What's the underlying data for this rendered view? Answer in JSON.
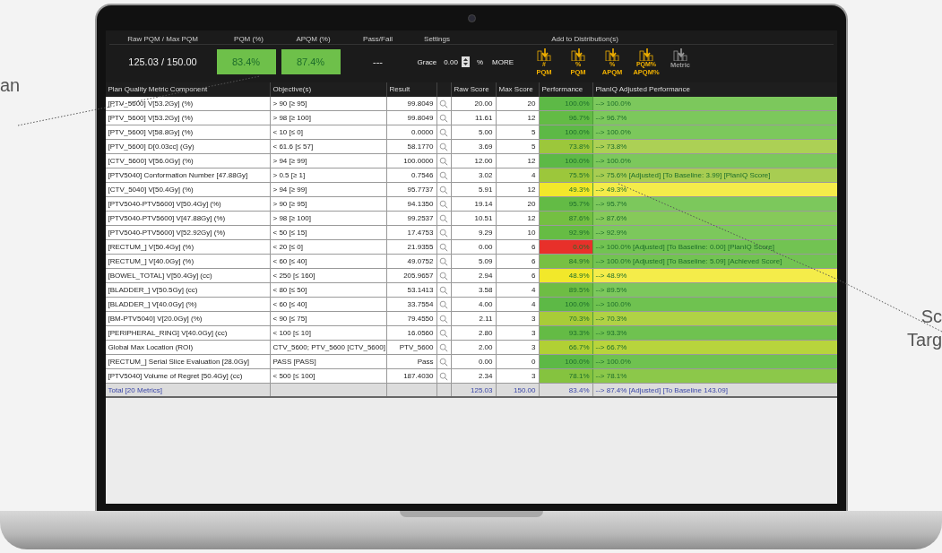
{
  "callouts_left": [
    "an"
  ],
  "callouts_right": [
    "Sc",
    "Targ"
  ],
  "summary": {
    "labels": [
      "Raw PQM  /  Max PQM",
      "PQM (%)",
      "APQM (%)",
      "Pass/Fail",
      "Settings",
      "Add to Distribution(s)"
    ],
    "raw_max": "125.03  /  150.00",
    "pqm": "83.4%",
    "apqm": "87.4%",
    "pass_fail": "---",
    "grace_label": "Grace",
    "grace_value": "0.00",
    "grace_unit": "%",
    "more": "MORE"
  },
  "distribution_buttons": [
    {
      "top": "#",
      "label": "PQM",
      "disabled": false
    },
    {
      "top": "%",
      "label": "PQM",
      "disabled": false
    },
    {
      "top": "%",
      "label": "APQM",
      "disabled": false
    },
    {
      "top": "PQM%",
      "label": "APQM%",
      "disabled": false
    },
    {
      "label": "Metric",
      "disabled": true
    }
  ],
  "table": {
    "columns": [
      "Plan Quality Metric Component",
      "Objective(s)",
      "Result",
      "",
      "Raw Score",
      "Max Score",
      "Performance",
      "PlanIQ Adjusted Performance"
    ],
    "rows": [
      {
        "component": "[PTV_5600] V[53.2Gy] (%)",
        "objective": "> 90 [≥ 95]",
        "result": "99.8049",
        "raw": "20.00",
        "max": "20",
        "performance": "100.0%",
        "color": "#5db946",
        "adjusted": {
          "text": "--> 100.0%",
          "color": "#7cc85c"
        }
      },
      {
        "component": "[PTV_5600] V[53.2Gy] (%)",
        "objective": "> 98 [≥ 100]",
        "result": "99.8049",
        "raw": "11.61",
        "max": "12",
        "performance": "96.7%",
        "color": "#63bb45",
        "adjusted": {
          "text": "--> 96.7%",
          "color": "#7cc85c"
        }
      },
      {
        "component": "[PTV_5600] V[58.8Gy] (%)",
        "objective": "< 10 [≤ 0]",
        "result": "0.0000",
        "raw": "5.00",
        "max": "5",
        "performance": "100.0%",
        "color": "#5db946",
        "adjusted": {
          "text": "--> 100.0%",
          "color": "#7cc85c"
        }
      },
      {
        "component": "[PTV_5600] D[0.03cc] (Gy)",
        "objective": "< 61.6 [≤ 57]",
        "result": "58.1770",
        "raw": "3.69",
        "max": "5",
        "performance": "73.8%",
        "color": "#9cc73b",
        "adjusted": {
          "text": "--> 73.8%",
          "color": "#acd055"
        }
      },
      {
        "component": "[CTV_5600] V[56.0Gy] (%)",
        "objective": "> 94 [≥ 99]",
        "result": "100.0000",
        "raw": "12.00",
        "max": "12",
        "performance": "100.0%",
        "color": "#5db946",
        "adjusted": {
          "text": "--> 100.0%",
          "color": "#7cc85c"
        }
      },
      {
        "component": "[PTV5040] Conformation Number  [47.88Gy]",
        "objective": "> 0.5 [≥ 1]",
        "result": "0.7546",
        "raw": "3.02",
        "max": "4",
        "performance": "75.5%",
        "color": "#9cc73b",
        "adjusted": {
          "text": "--> 75.6% [Adjusted] [To Baseline: 3.99] [PlanIQ Score]",
          "color": "#a8cd52"
        }
      },
      {
        "component": "[CTV_5040] V[50.4Gy] (%)",
        "objective": "> 94 [≥ 99]",
        "result": "95.7737",
        "raw": "5.91",
        "max": "12",
        "performance": "49.3%",
        "color": "#f2e82a",
        "adjusted": {
          "text": "--> 49.3%",
          "color": "#f4ec4a"
        }
      },
      {
        "component": "[PTV5040-PTV5600] V[50.4Gy] (%)",
        "objective": "> 90 [≥ 95]",
        "result": "94.1350",
        "raw": "19.14",
        "max": "20",
        "performance": "95.7%",
        "color": "#63bb45",
        "adjusted": {
          "text": "--> 95.7%",
          "color": "#7cc85c"
        }
      },
      {
        "component": "[PTV5040-PTV5600] V[47.88Gy] (%)",
        "objective": "> 98 [≥ 100]",
        "result": "99.2537",
        "raw": "10.51",
        "max": "12",
        "performance": "87.6%",
        "color": "#74bf42",
        "adjusted": {
          "text": "--> 87.6%",
          "color": "#86c95a"
        }
      },
      {
        "component": "[PTV5040-PTV5600] V[52.92Gy] (%)",
        "objective": "< 50 [≤ 15]",
        "result": "17.4753",
        "raw": "9.29",
        "max": "10",
        "performance": "92.9%",
        "color": "#66bc44",
        "adjusted": {
          "text": "--> 92.9%",
          "color": "#7cc85c"
        }
      },
      {
        "component": "[RECTUM_] V[50.4Gy] (%)",
        "objective": "< 20 [≤ 0]",
        "result": "21.9355",
        "raw": "0.00",
        "max": "6",
        "performance": "0.0%",
        "color": "#e8302a",
        "adjusted": {
          "text": "--> 100.0% [Adjusted] [To Baseline: 0.00] [PlanIQ Score]",
          "color": "#72c352"
        }
      },
      {
        "component": "[RECTUM_] V[40.0Gy] (%)",
        "objective": "< 60 [≤ 40]",
        "result": "49.0752",
        "raw": "5.09",
        "max": "6",
        "performance": "84.9%",
        "color": "#78c043",
        "adjusted": {
          "text": "--> 100.0% [Adjusted] [To Baseline: 5.09] [Achieved Score]",
          "color": "#72c352"
        }
      },
      {
        "component": "[BOWEL_TOTAL] V[50.4Gy] (cc)",
        "objective": "< 250 [≤ 160]",
        "result": "205.9657",
        "raw": "2.94",
        "max": "6",
        "performance": "48.9%",
        "color": "#f2e82a",
        "adjusted": {
          "text": "--> 48.9%",
          "color": "#f4ec4a"
        }
      },
      {
        "component": "[BLADDER_] V[50.5Gy] (cc)",
        "objective": "< 80 [≤ 50]",
        "result": "53.1413",
        "raw": "3.58",
        "max": "4",
        "performance": "89.5%",
        "color": "#6ebd44",
        "adjusted": {
          "text": "--> 89.5%",
          "color": "#7cc85c"
        }
      },
      {
        "component": "[BLADDER_] V[40.0Gy] (%)",
        "objective": "< 60 [≤ 40]",
        "result": "33.7554",
        "raw": "4.00",
        "max": "4",
        "performance": "100.0%",
        "color": "#5db946",
        "adjusted": {
          "text": "--> 100.0%",
          "color": "#6fc250"
        }
      },
      {
        "component": "[BM-PTV5040] V[20.0Gy] (%)",
        "objective": "< 90 [≤ 75]",
        "result": "79.4550",
        "raw": "2.11",
        "max": "3",
        "performance": "70.3%",
        "color": "#a8cc38",
        "adjusted": {
          "text": "--> 70.3%",
          "color": "#b0d245"
        }
      },
      {
        "component": "[PERIPHERAL_RING] V[40.0Gy] (cc)",
        "objective": "< 100 [≤ 10]",
        "result": "16.0560",
        "raw": "2.80",
        "max": "3",
        "performance": "93.3%",
        "color": "#64bb45",
        "adjusted": {
          "text": "--> 93.3%",
          "color": "#6fc250"
        }
      },
      {
        "component": "Global Max Location (ROI)",
        "objective": "CTV_5600; PTV_5600 [CTV_5600]",
        "result": "PTV_5600",
        "raw": "2.00",
        "max": "3",
        "performance": "66.7%",
        "color": "#b1d034",
        "adjusted": {
          "text": "--> 66.7%",
          "color": "#b8d43c"
        }
      },
      {
        "component": "[RECTUM_] Serial Slice Evaluation  [28.0Gy]",
        "objective": "PASS [PASS]",
        "result": "Pass",
        "raw": "0.00",
        "max": "0",
        "performance": "100.0%",
        "color": "#5db946",
        "adjusted": {
          "text": "--> 100.0%",
          "color": "#6fc250"
        }
      },
      {
        "component": "[PTV5040] Volume of Regret  [50.4Gy] (cc)",
        "objective": "< 500 [≤ 100]",
        "result": "187.4030",
        "raw": "2.34",
        "max": "3",
        "performance": "78.1%",
        "color": "#85c33f",
        "adjusted": {
          "text": "--> 78.1%",
          "color": "#8cc84a"
        }
      }
    ],
    "total": {
      "component": "Total [20 Metrics]",
      "raw": "125.03",
      "max": "150.00",
      "performance": "83.4%",
      "adjusted": "--> 87.4% [Adjusted] [To Baseline 143.09]"
    }
  }
}
